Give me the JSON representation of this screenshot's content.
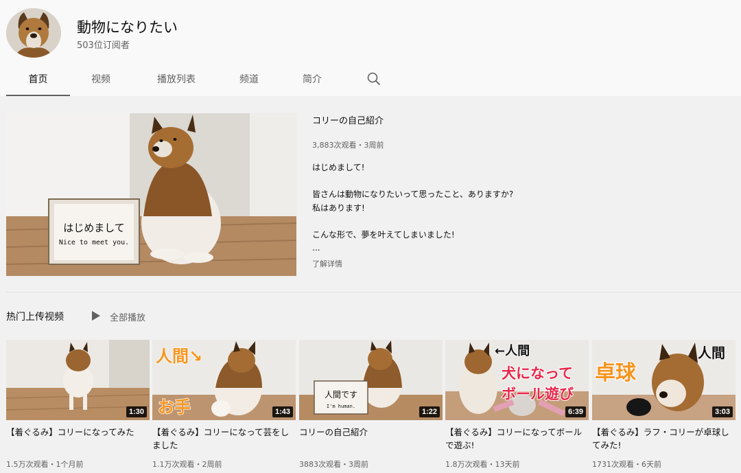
{
  "channel": {
    "name": "動物になりたい",
    "subscribers": "503位订阅者"
  },
  "tabs": [
    {
      "label": "首页",
      "active": true
    },
    {
      "label": "视频"
    },
    {
      "label": "播放列表"
    },
    {
      "label": "频道"
    },
    {
      "label": "简介"
    }
  ],
  "featured": {
    "title": "コリーの自己紹介",
    "meta": "3,883次观看・3周前",
    "sign_jp": "はじめまして",
    "sign_en": "Nice to meet you.",
    "description": [
      "はじめまして!",
      "",
      "皆さんは動物になりたいって思ったこと、ありますか?",
      "私はあります!",
      "",
      "こんな形で、夢を叶えてしまいました!",
      "..."
    ],
    "more_label": "了解详情"
  },
  "shelf": {
    "title": "热门上传视频",
    "play_all": "全部播放",
    "videos": [
      {
        "title": "【着ぐるみ】コリーになってみた",
        "meta": "1.5万次观看・1个月前",
        "duration": "1:30",
        "overlay": []
      },
      {
        "title": "【着ぐるみ】コリーになって芸をしました",
        "meta": "1.1万次观看・2周前",
        "duration": "1:43",
        "overlay": [
          "人間↘",
          "お手"
        ]
      },
      {
        "title": "コリーの自己紹介",
        "meta": "3883次观看・3周前",
        "duration": "1:22",
        "overlay": [
          "人間です",
          "I'm human."
        ]
      },
      {
        "title": "【着ぐるみ】コリーになってボールで遊ぶ!",
        "meta": "1.8万次观看・13天前",
        "duration": "6:39",
        "overlay": [
          "←人間",
          "犬になって",
          "ボール遊び"
        ]
      },
      {
        "title": "【着ぐるみ】ラフ・コリーが卓球してみた!",
        "meta": "1731次观看・6天前",
        "duration": "3:03",
        "overlay": [
          "卓球",
          "人間"
        ]
      }
    ]
  },
  "colors": {
    "accent_orange": "#f7941d",
    "accent_red": "#e8264a",
    "muted_text": "#606060"
  }
}
